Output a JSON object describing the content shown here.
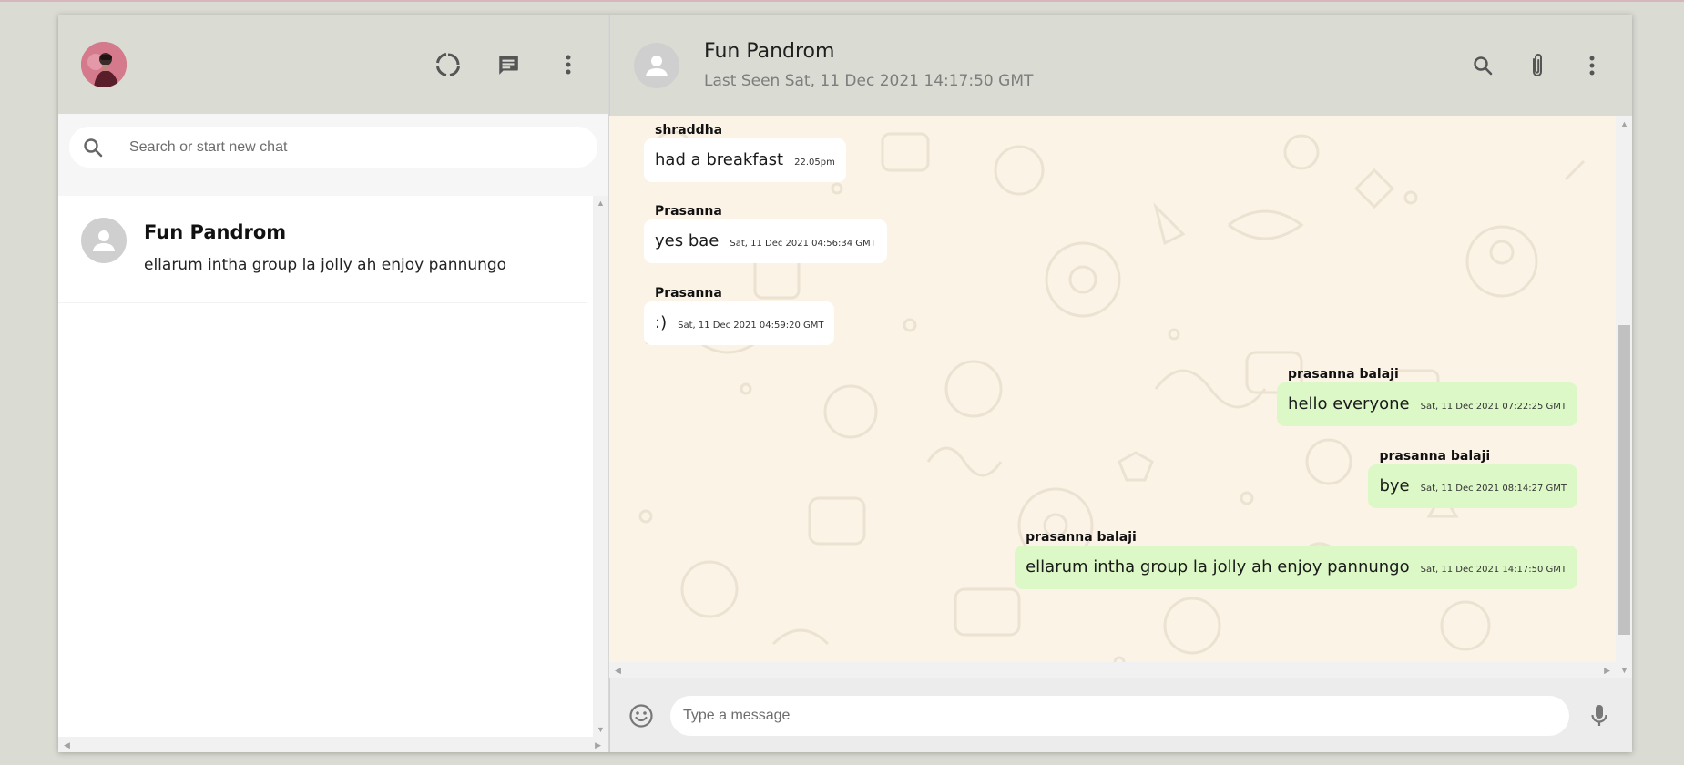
{
  "sidebar": {
    "header": {
      "avatar_icon": "user-photo",
      "icons": [
        "status-icon",
        "new-chat-icon",
        "more-vert-icon"
      ]
    },
    "search": {
      "placeholder": "Search or start new chat",
      "icon": "search-icon"
    },
    "chats": [
      {
        "name": "Fun Pandrom",
        "last_message": "ellarum intha group la jolly ah enjoy pannungo"
      }
    ]
  },
  "chat": {
    "header": {
      "name": "Fun Pandrom",
      "last_seen": "Last Seen Sat, 11 Dec 2021 14:17:50 GMT",
      "icons": [
        "search-icon",
        "attach-icon",
        "more-vert-icon"
      ]
    },
    "messages": [
      {
        "sender": "shraddha",
        "text": "had a breakfast",
        "time": "22.05pm",
        "direction": "in"
      },
      {
        "sender": "Prasanna",
        "text": "yes bae",
        "time": "Sat, 11 Dec 2021 04:56:34 GMT",
        "direction": "in"
      },
      {
        "sender": "Prasanna",
        "text": ":)",
        "time": "Sat, 11 Dec 2021 04:59:20 GMT",
        "direction": "in"
      },
      {
        "sender": "prasanna balaji",
        "text": "hello everyone",
        "time": "Sat, 11 Dec 2021 07:22:25 GMT",
        "direction": "out"
      },
      {
        "sender": "prasanna balaji",
        "text": "bye",
        "time": "Sat, 11 Dec 2021 08:14:27 GMT",
        "direction": "out"
      },
      {
        "sender": "prasanna balaji",
        "text": "ellarum intha group la jolly ah enjoy pannungo",
        "time": "Sat, 11 Dec 2021 14:17:50 GMT",
        "direction": "out"
      }
    ],
    "composer": {
      "placeholder": "Type a message",
      "emoji_icon": "emoji-icon",
      "mic_icon": "mic-icon"
    }
  },
  "colors": {
    "header_bg": "#dadbd3",
    "chat_bg": "#fbf3e6",
    "outgoing_bubble": "#dcf8c6",
    "incoming_bubble": "#ffffff"
  }
}
